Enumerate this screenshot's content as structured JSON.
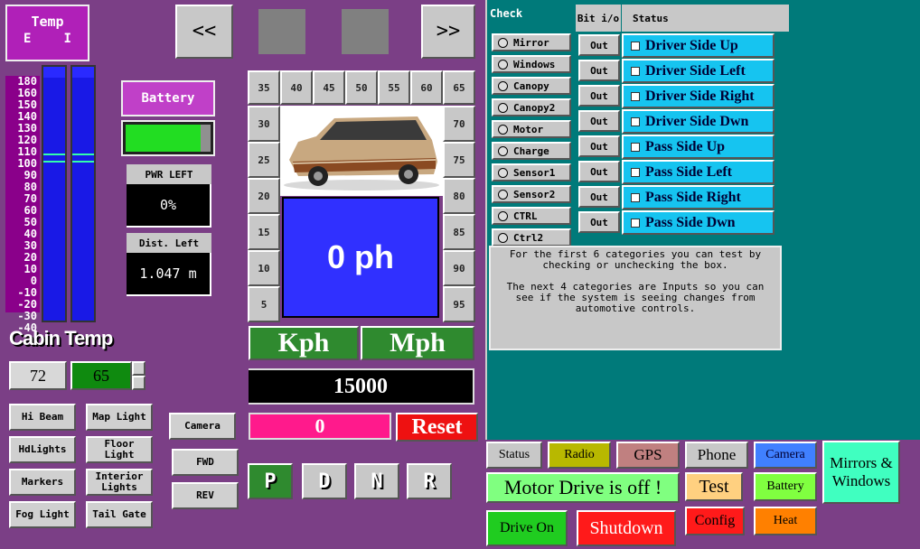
{
  "temp": {
    "title": "Temp",
    "e": "E",
    "i": "I"
  },
  "scale": [
    "180",
    "160",
    "150",
    "140",
    "130",
    "120",
    "110",
    "100",
    "90",
    "80",
    "70",
    "60",
    "50",
    "40",
    "30",
    "20",
    "10",
    "0",
    "-10",
    "-20",
    "-30",
    "-40"
  ],
  "gauges": {
    "bar1_fraction": 0.74,
    "bar2_fraction": 0.74
  },
  "battery": {
    "label": "Battery",
    "fill_fraction": 0.88,
    "fill_color": "#22dd22"
  },
  "power": {
    "label": "PWR LEFT",
    "value": "0%"
  },
  "distance": {
    "label": "Dist. Left",
    "value": "1.047 m"
  },
  "cabin": {
    "title": "Cabin Temp",
    "set_a": "72",
    "set_b": "65"
  },
  "light_buttons": [
    "Hi Beam",
    "Map Light",
    "HdLights",
    "Floor Light",
    "Markers",
    "Interior Lights",
    "Fog Light",
    "Tail Gate"
  ],
  "nav": {
    "prev": "<<",
    "next": ">>"
  },
  "view_buttons": {
    "camera": "Camera",
    "fwd": "FWD",
    "rev": "REV"
  },
  "speed_ring": {
    "top": [
      "35",
      "40",
      "45",
      "50",
      "55",
      "60",
      "65"
    ],
    "left": [
      "30",
      "25",
      "20",
      "15",
      "10",
      "5"
    ],
    "right": [
      "70",
      "75",
      "80",
      "85",
      "90",
      "95"
    ]
  },
  "speed": {
    "value": "0 ph",
    "kph": "Kph",
    "mph": "Mph",
    "odometer": "15000",
    "trip": "0",
    "reset": "Reset"
  },
  "gears": [
    "P",
    "D",
    "N",
    "R"
  ],
  "check": {
    "header_check": "Check",
    "header_bit": "Bit i/o",
    "header_status": "Status",
    "items": [
      "Mirror",
      "Windows",
      "Canopy",
      "Canopy2",
      "Motor",
      "Charge",
      "Sensor1",
      "Sensor2",
      "CTRL",
      "Ctrl2"
    ],
    "bits": [
      "Out",
      "Out",
      "Out",
      "Out",
      "Out",
      "Out",
      "Out",
      "Out"
    ],
    "statuses": [
      "Driver Side Up",
      "Driver Side Left",
      "Driver Side Right",
      "Driver Side Dwn",
      "Pass Side Up",
      "Pass Side Left",
      "Pass Side Right",
      "Pass Side Dwn"
    ],
    "help1": "For the first 6 categories you can test by checking or unchecking the box.",
    "help2": "The next 4 categories are Inputs so you can see if the system is seeing changes from automotive controls."
  },
  "bottom": {
    "status": "Status",
    "radio": "Radio",
    "gps": "GPS",
    "phone": "Phone",
    "camera": "Camera",
    "mirrors": "Mirrors & Windows",
    "motor_msg": "Motor Drive is off !",
    "test": "Test",
    "battery": "Battery",
    "drive_on": "Drive On",
    "shutdown": "Shutdown",
    "config": "Config",
    "heat": "Heat"
  }
}
